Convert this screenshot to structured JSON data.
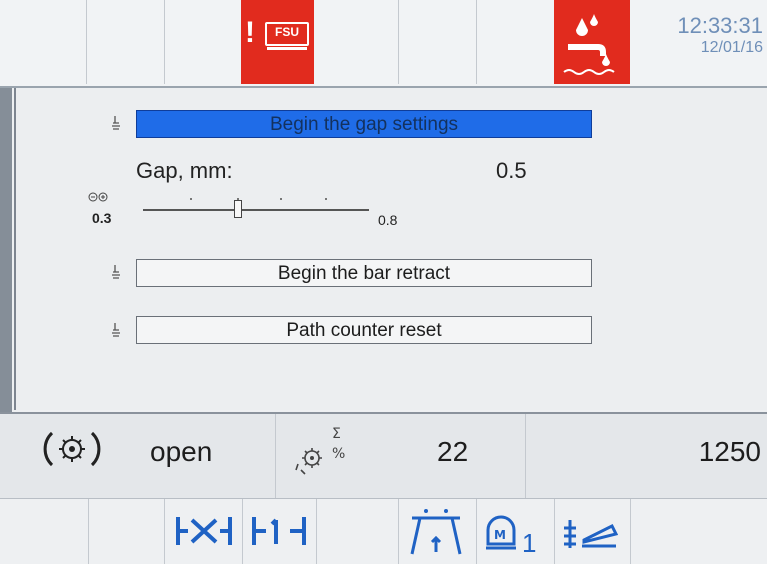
{
  "header": {
    "fsu_badge": "FSU",
    "alert_mark": "!",
    "time": "12:33:31",
    "date": "12/01/16"
  },
  "actions": {
    "gap_settings": "Begin the gap settings",
    "bar_retract": "Begin the bar retract",
    "path_counter_reset": "Path counter reset"
  },
  "gap": {
    "label": "Gap, mm:",
    "value": "0.5",
    "slider_min": "0.3",
    "slider_max": "0.8",
    "slider_level": 0.42
  },
  "status": {
    "clamp_state": "open",
    "counter": "22",
    "total": "1250"
  },
  "toolbar": {
    "manual_mode_suffix": "1"
  },
  "icons": {
    "fsu": "fsu-alarm-icon",
    "coolant": "coolant-icon",
    "row_marker": "hand-pointer-icon",
    "gap_adjust": "gap-adjust-icon",
    "clamp": "clamp-gear-icon",
    "counter": "sum-percent-gear-icon",
    "gap_tool": "gap-tool-icon",
    "edge_tool": "edge-tool-icon",
    "path": "path-icon",
    "manual": "manual-mode-icon",
    "bar": "bar-feed-icon"
  },
  "colors": {
    "alert_red": "#e12b1e",
    "selection_blue": "#1f6ce8",
    "icon_blue": "#1f62c4",
    "clock_blue": "#6f8fb8"
  }
}
